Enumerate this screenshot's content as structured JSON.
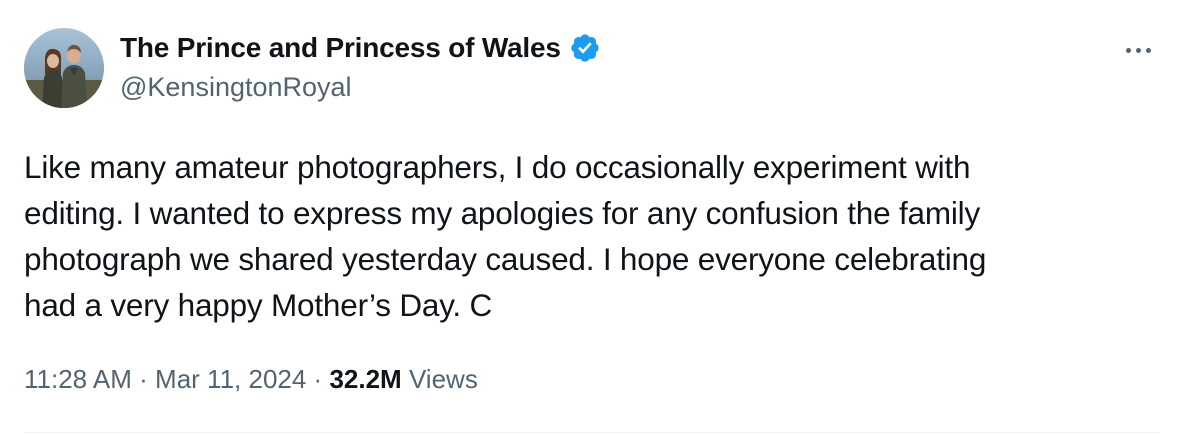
{
  "author": {
    "display_name": "The Prince and Princess of Wales",
    "handle": "@KensingtonRoyal",
    "verified": true,
    "verified_color": "#1d9bf0",
    "avatar_icon": "couple-photo-avatar"
  },
  "more_icon": "more-options-icon",
  "tweet": {
    "text_lines": [
      "Like many amateur photographers, I do occasionally experiment with",
      "editing. I wanted to express my apologies for any confusion the family",
      "photograph we shared yesterday caused. I hope everyone celebrating",
      "had a very happy Mother’s Day. C"
    ]
  },
  "meta": {
    "time": "11:28 AM",
    "separator": " · ",
    "date": "Mar 11, 2024",
    "views_count": "32.2M",
    "views_label": "Views"
  },
  "colors": {
    "text": "#0f1419",
    "secondary": "#536471",
    "divider": "#eff3f4"
  }
}
